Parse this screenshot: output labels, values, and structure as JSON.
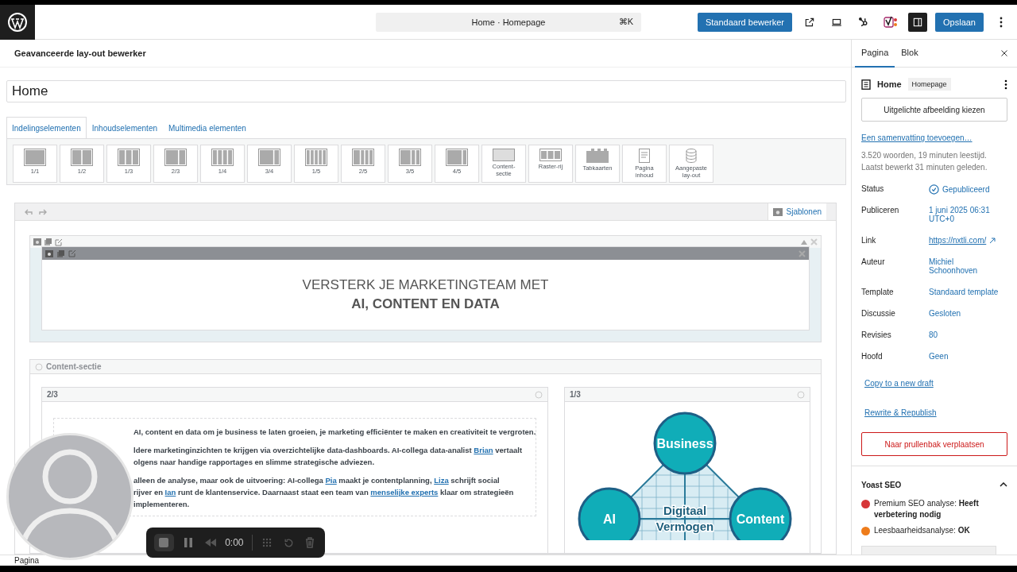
{
  "header": {
    "command_title": "Home · Homepage",
    "command_shortcut": "⌘K",
    "editor_button": "Standaard bewerker",
    "sidebar_toggle_on": true,
    "save_button": "Opslaan"
  },
  "editor": {
    "title": "Geavanceerde lay-out bewerker",
    "page_title": "Home",
    "tabs": [
      {
        "label": "Indelingselementen",
        "selected": true
      },
      {
        "label": "Inhoudselementen",
        "selected": false
      },
      {
        "label": "Multimedia elementen",
        "selected": false
      }
    ],
    "elements": [
      {
        "label": "1/1"
      },
      {
        "label": "1/2"
      },
      {
        "label": "1/3"
      },
      {
        "label": "2/3"
      },
      {
        "label": "1/4"
      },
      {
        "label": "3/4"
      },
      {
        "label": "1/5"
      },
      {
        "label": "2/5"
      },
      {
        "label": "3/5"
      },
      {
        "label": "4/5"
      },
      {
        "label": "Content-\nsectie"
      },
      {
        "label": "Raster-rij"
      },
      {
        "label": "Tabkaarten"
      },
      {
        "label": "Pagina\ninhoud"
      },
      {
        "label": "Aangepaste\nlay-out"
      }
    ]
  },
  "builder": {
    "templates_button": "Sjablonen",
    "hero": {
      "line1": "VERSTERK JE MARKETINGTEAM MET",
      "line2": "AI, CONTENT EN DATA"
    },
    "section": {
      "label": "Content-sectie",
      "columns": [
        {
          "label": "2/3",
          "kind": "text",
          "lines": [
            [
              {
                "text": "AI, content en data om je business te laten groeien, je marketing efficiënter te maken en creativiteit te vergroten.",
                "link": false
              }
            ],
            [
              {
                "text": "ldere marketinginzichten te krijgen via overzichtelijke data-dashboards. AI-collega data-analist ",
                "link": false
              },
              {
                "text": "Brian",
                "link": true
              },
              {
                "text": " vertaalt",
                "link": false
              }
            ],
            [
              {
                "text": "olgens naar handige rapportages en slimme strategische adviezen.",
                "link": false
              }
            ],
            [
              {
                "text": "alleen de analyse, maar ook de uitvoering: AI-collega ",
                "link": false
              },
              {
                "text": "Pia",
                "link": true
              },
              {
                "text": " maakt je contentplanning, ",
                "link": false
              },
              {
                "text": "Liza",
                "link": true
              },
              {
                "text": " schrijft social",
                "link": false
              }
            ],
            [
              {
                "text": "rijver en ",
                "link": false
              },
              {
                "text": "Ian",
                "link": true
              },
              {
                "text": " runt de klantenservice. Daarnaast staat een team van ",
                "link": false
              },
              {
                "text": "menselijke experts",
                "link": true
              },
              {
                "text": " klaar om strategieën",
                "link": false
              }
            ],
            [
              {
                "text": "implementeren.",
                "link": false
              }
            ]
          ]
        },
        {
          "label": "1/3",
          "kind": "diagram",
          "nodes": [
            "Business",
            "AI",
            "Content"
          ],
          "center": [
            "Digitaal",
            "Vermogen"
          ]
        }
      ]
    }
  },
  "sidebar": {
    "tabs": [
      {
        "label": "Pagina",
        "selected": true
      },
      {
        "label": "Blok",
        "selected": false
      }
    ],
    "page": {
      "title": "Home",
      "badge": "Homepage"
    },
    "featured_image_button": "Uitgelichte afbeelding kiezen",
    "excerpt_link": "Een samenvatting toevoegen…",
    "stats": [
      "3.520 woorden, 19 minuten leestijd.",
      "Laatst bewerkt 31 minuten geleden."
    ],
    "fields": [
      {
        "label": "Status",
        "value": "Gepubliceerd",
        "kind": "status"
      },
      {
        "label": "Publiceren",
        "value": "1 juni 2025 06:31\nUTC+0",
        "kind": "text"
      },
      {
        "label": "Link",
        "value": "https://nxtli.com/",
        "kind": "url"
      },
      {
        "label": "Auteur",
        "value": "Michiel\nSchoonhoven",
        "kind": "text"
      },
      {
        "label": "Template",
        "value": "Standaard template",
        "kind": "text"
      },
      {
        "label": "Discussie",
        "value": "Gesloten",
        "kind": "text"
      },
      {
        "label": "Revisies",
        "value": "80",
        "kind": "text"
      },
      {
        "label": "Hoofd",
        "value": "Geen",
        "kind": "text"
      }
    ],
    "links": [
      "Copy to a new draft",
      "Rewrite & Republish"
    ],
    "trash_button": "Naar prullenbak verplaatsen",
    "yoast": {
      "title": "Yoast SEO",
      "expanded": true,
      "checks": [
        {
          "label": "Premium SEO analyse: ",
          "result": "Heeft verbetering nodig",
          "color": "#d63638"
        },
        {
          "label": "Leesbaarheidsanalyse: ",
          "result": "OK",
          "color": "#ee7c1b"
        }
      ]
    }
  },
  "status_bar": "Pagina",
  "recorder": {
    "time": "0:00"
  }
}
